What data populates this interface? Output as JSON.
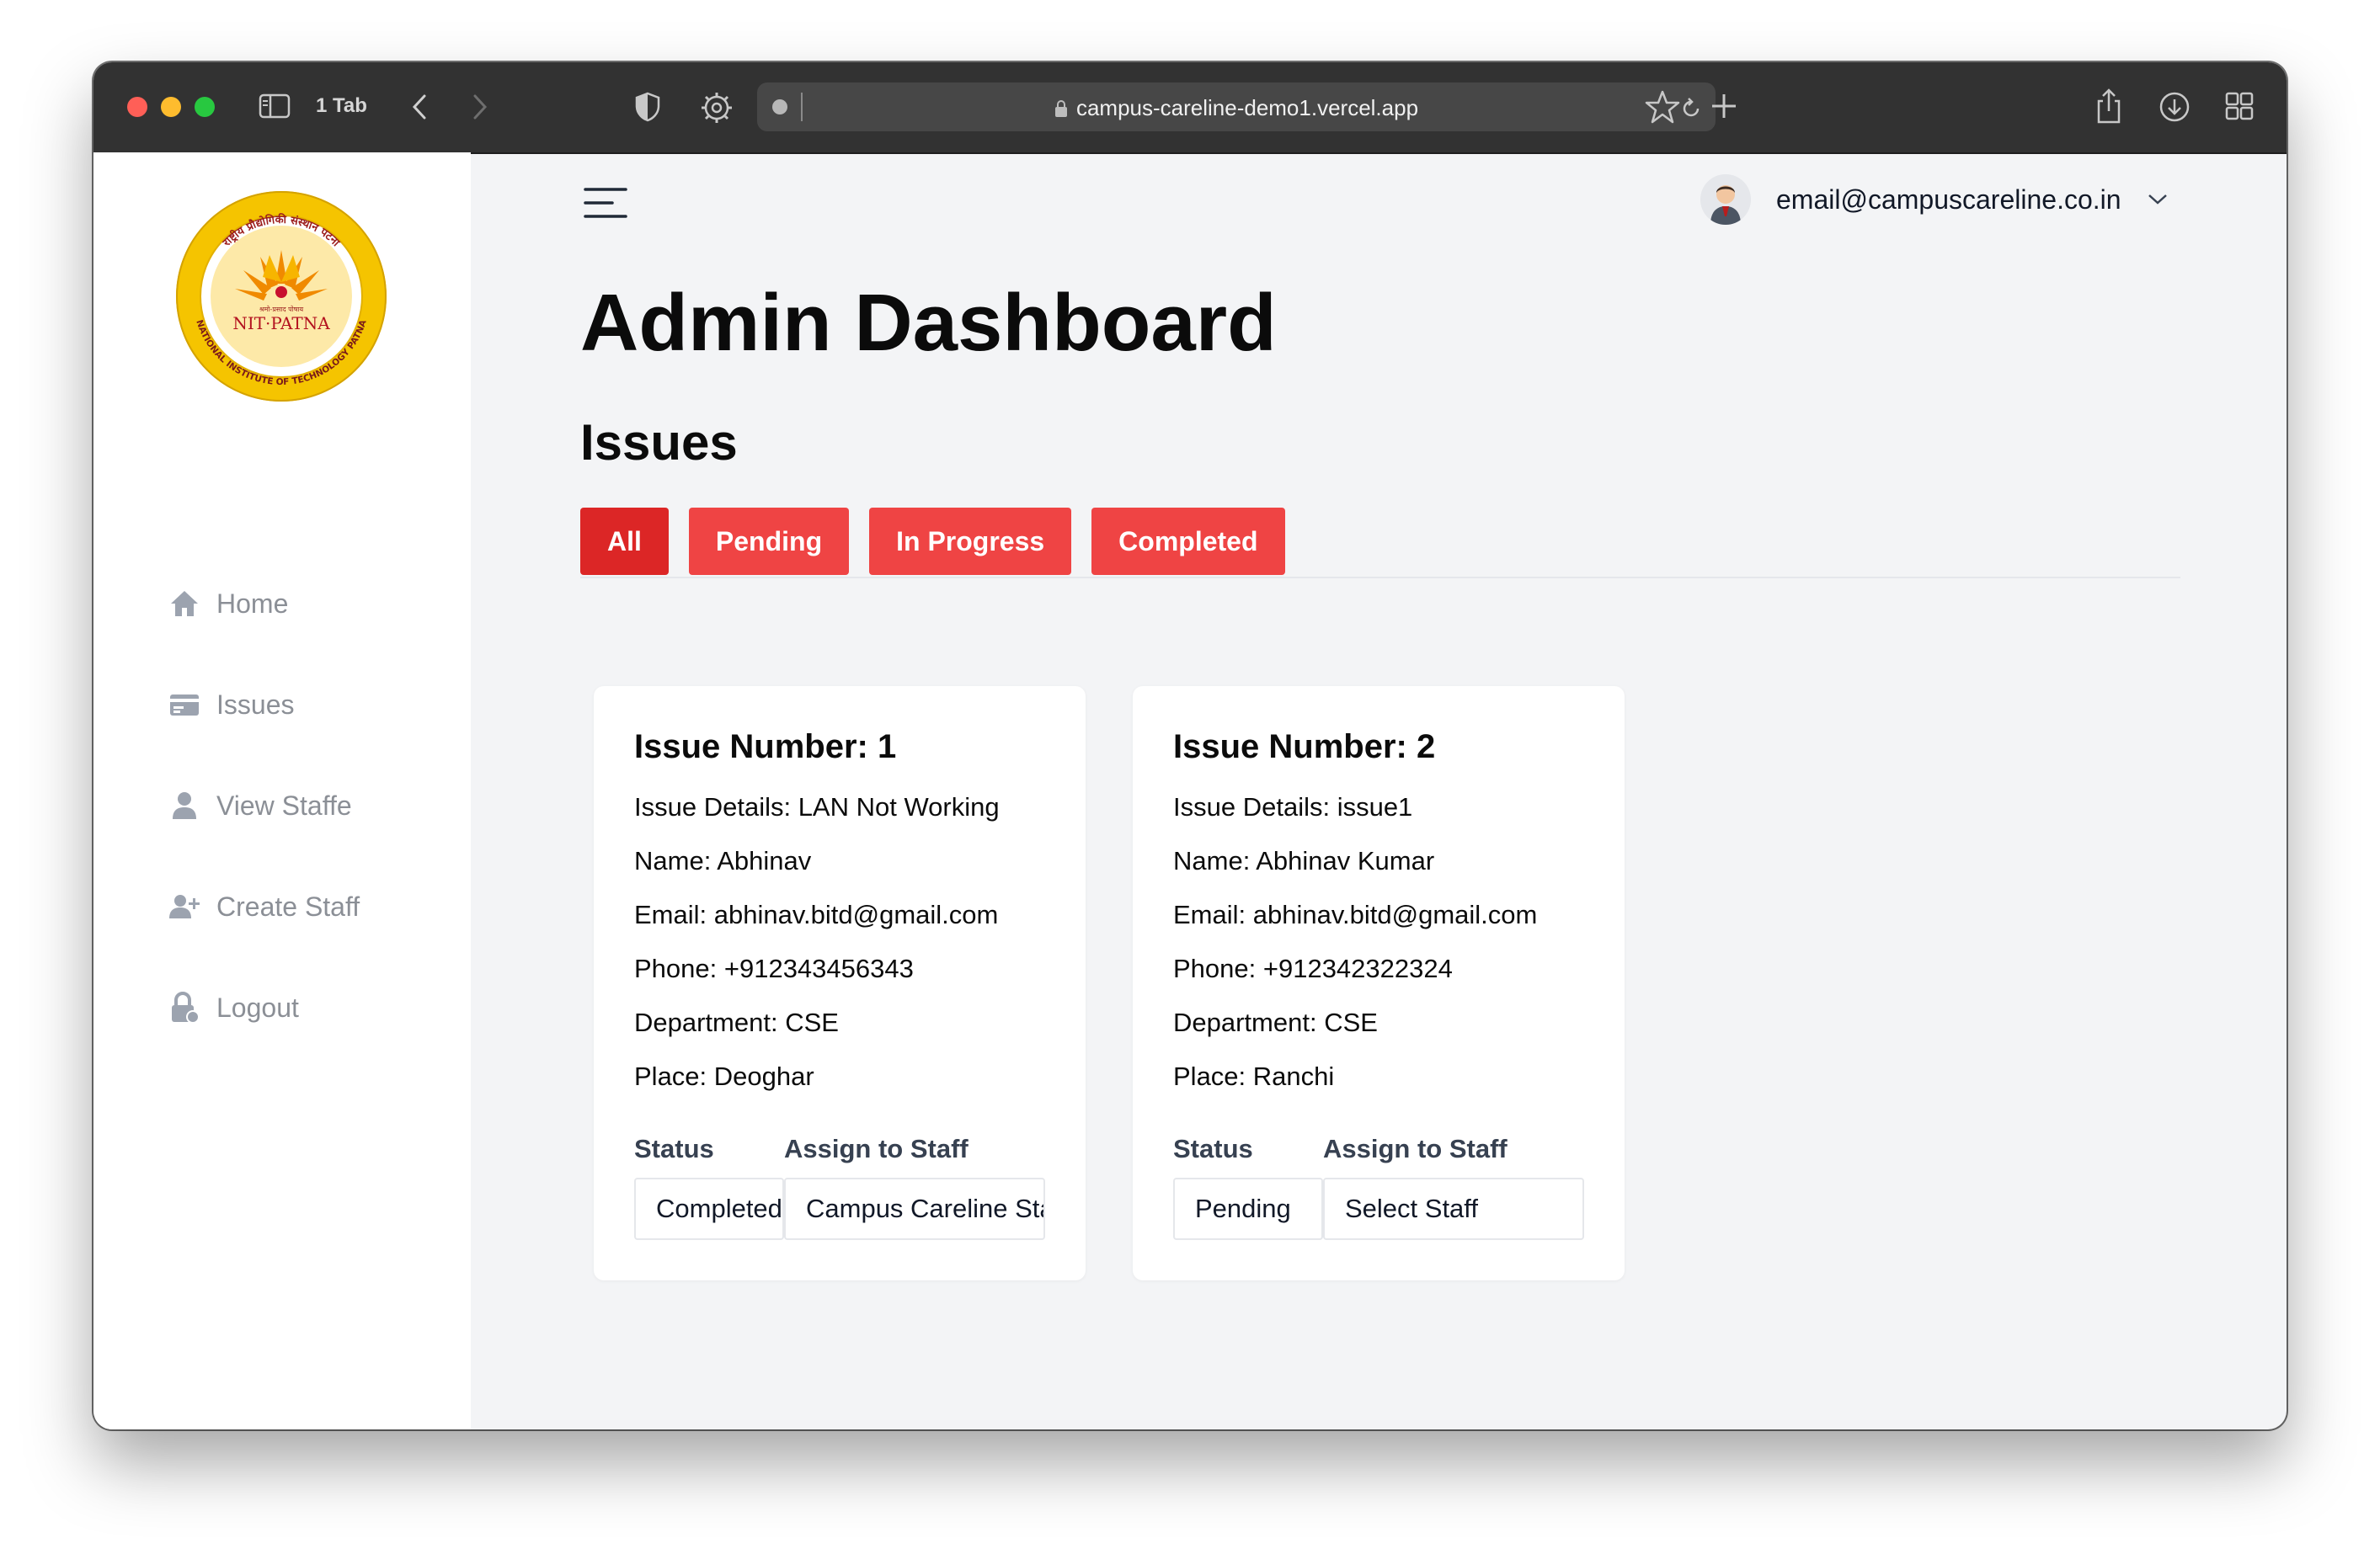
{
  "browser": {
    "tab_count": "1 Tab",
    "url": "campus-careline-demo1.vercel.app"
  },
  "logo": {
    "hindi_text": "राष्ट्रीय प्रौद्योगिकी संस्थान पटना",
    "name": "NIT·PATNA",
    "full_name": "NATIONAL INSTITUTE OF TECHNOLOGY PATNA",
    "tagline": "श्रमो-प्रसाद पोषाय"
  },
  "sidebar": {
    "items": [
      {
        "label": "Home",
        "icon": "home-icon"
      },
      {
        "label": "Issues",
        "icon": "card-icon"
      },
      {
        "label": "View Staffe",
        "icon": "user-icon"
      },
      {
        "label": "Create Staff",
        "icon": "user-plus-icon"
      },
      {
        "label": "Logout",
        "icon": "lock-icon"
      }
    ]
  },
  "header": {
    "user_email": "email@campuscareline.co.in"
  },
  "main": {
    "title": "Admin Dashboard",
    "section_title": "Issues",
    "tabs": [
      {
        "label": "All"
      },
      {
        "label": "Pending"
      },
      {
        "label": "In Progress"
      },
      {
        "label": "Completed"
      }
    ],
    "cards": [
      {
        "number": "Issue Number: 1",
        "details": "Issue Details: LAN Not Working",
        "name": "Name: Abhinav",
        "email": "Email: abhinav.bitd@gmail.com",
        "phone": "Phone: +912343456343",
        "department": "Department: CSE",
        "place": "Place: Deoghar",
        "status_label": "Status",
        "assign_label": "Assign to Staff",
        "status_value": "Completed",
        "assign_value": "Campus Careline Staff"
      },
      {
        "number": "Issue Number: 2",
        "details": "Issue Details: issue1",
        "name": "Name: Abhinav Kumar",
        "email": "Email: abhinav.bitd@gmail.com",
        "phone": "Phone: +912342322324",
        "department": "Department: CSE",
        "place": "Place: Ranchi",
        "status_label": "Status",
        "assign_label": "Assign to Staff",
        "status_value": "Pending",
        "assign_value": "Select Staff"
      }
    ]
  },
  "colors": {
    "accent": "#ef4444",
    "accent_active": "#dc2626",
    "background": "#f3f4f6"
  }
}
